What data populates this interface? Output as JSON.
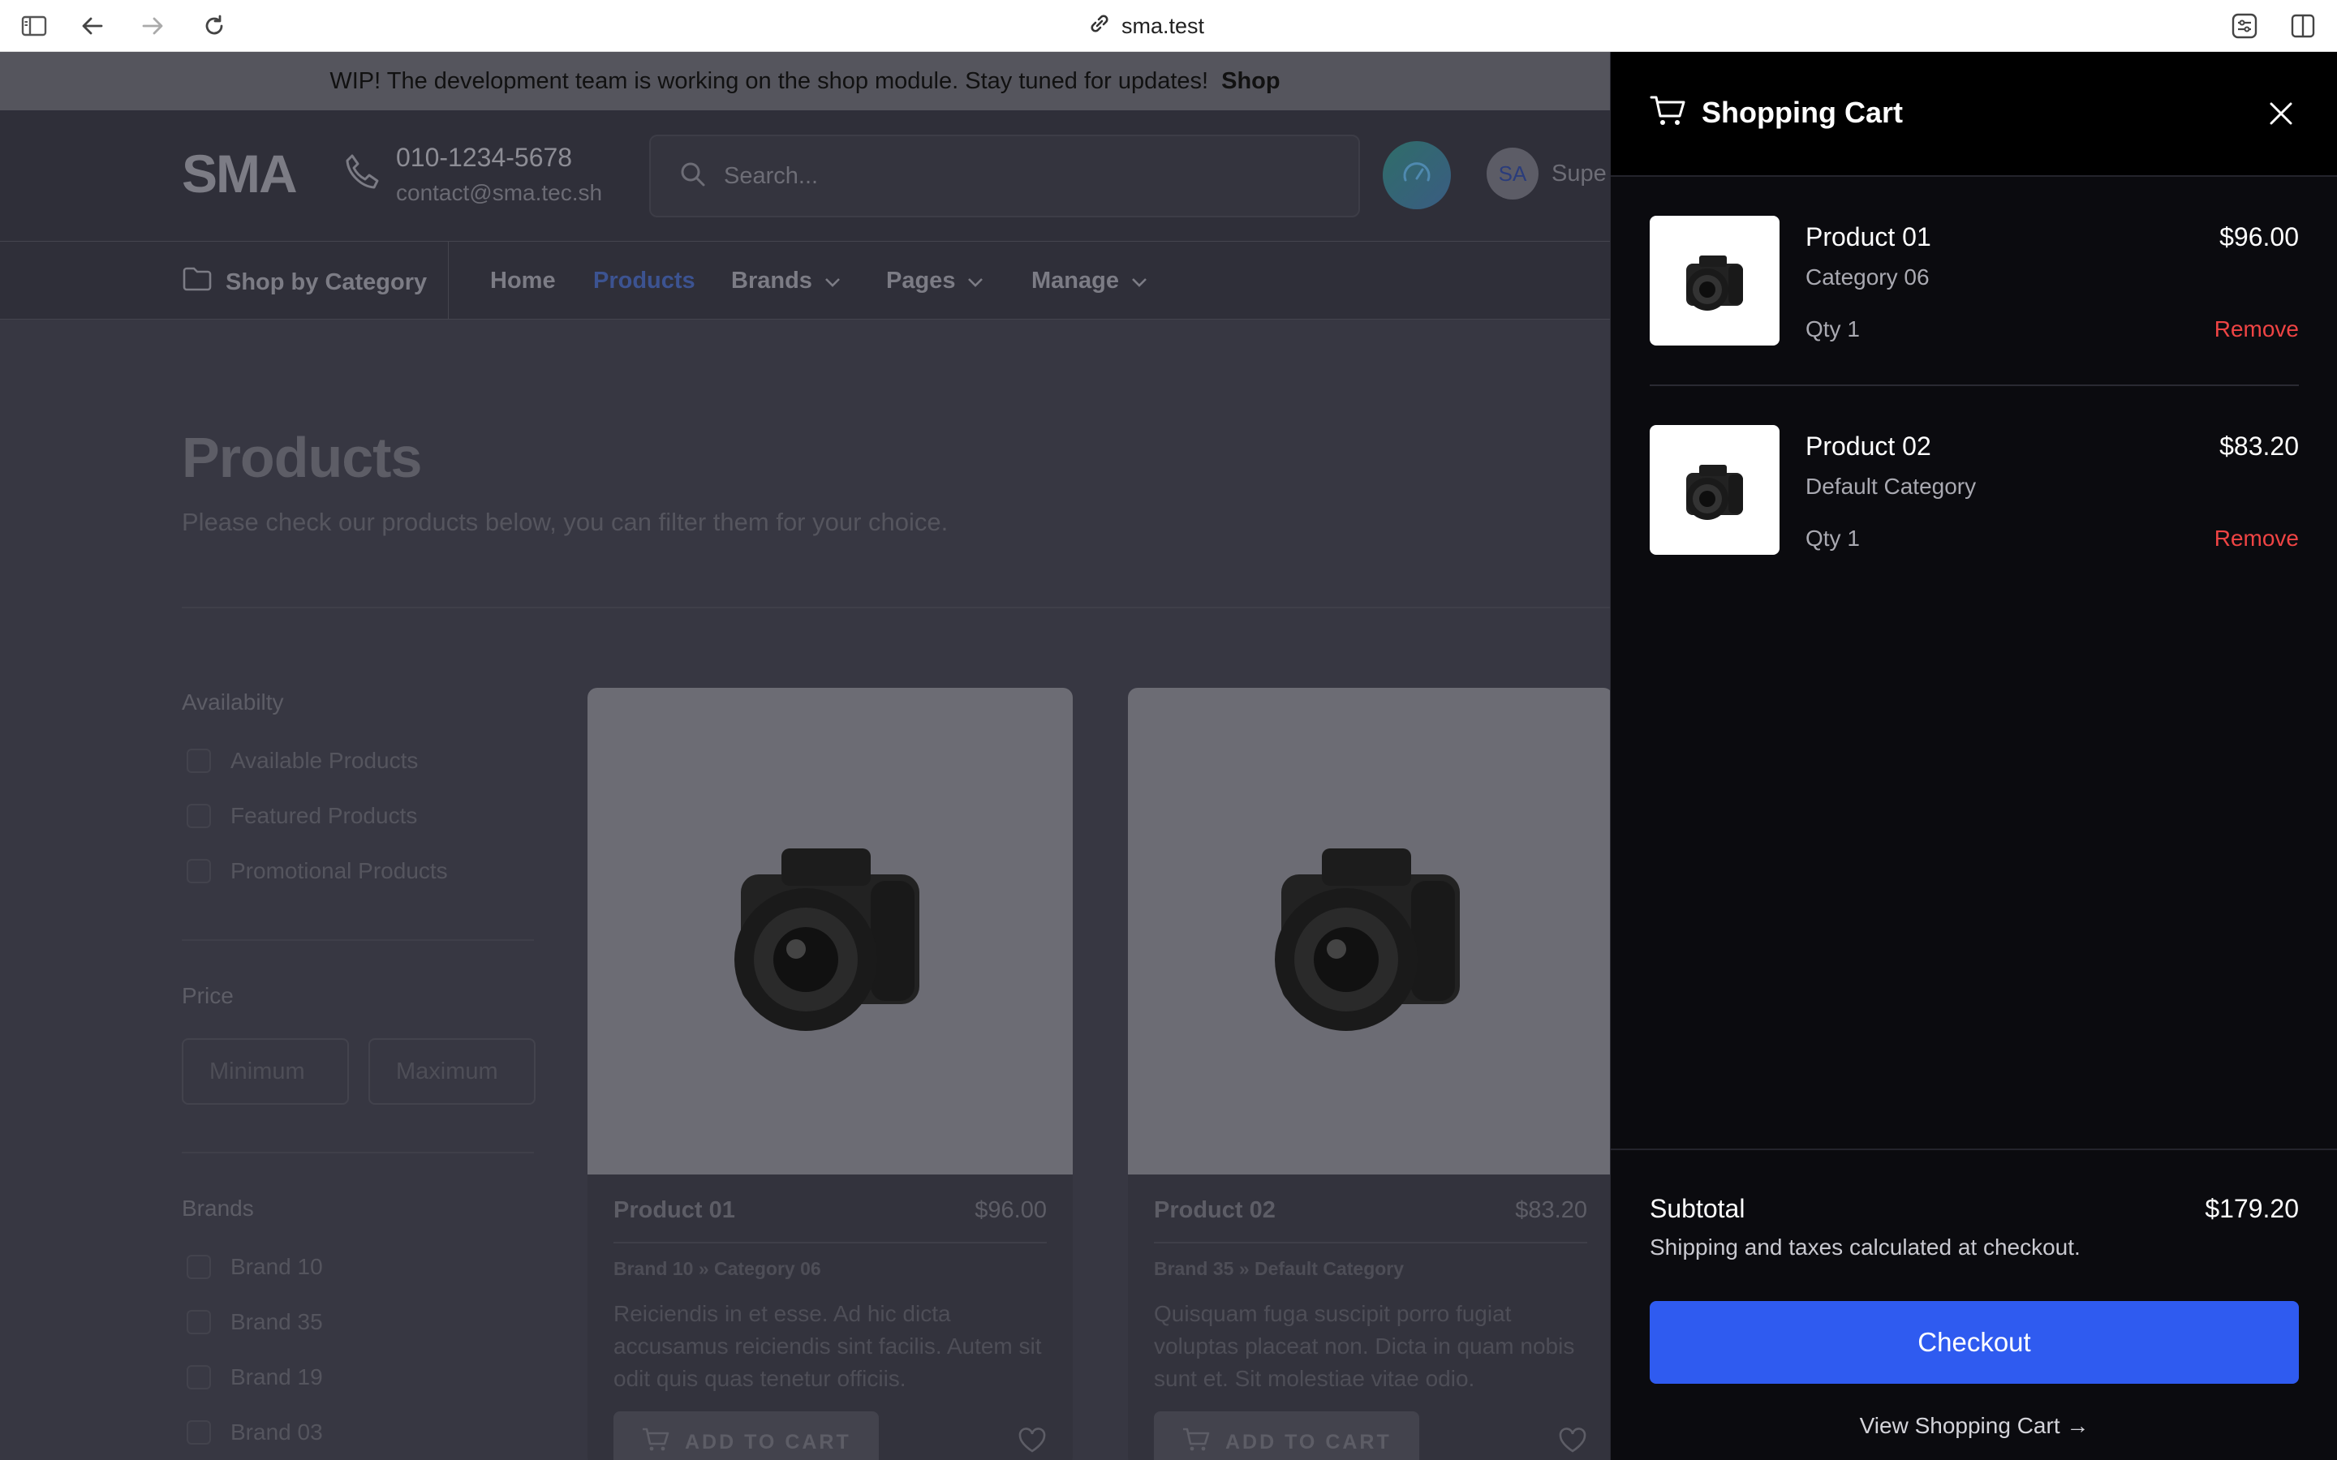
{
  "browser": {
    "url": "sma.test"
  },
  "announcement": {
    "text": "WIP! The development team is working on the shop module. Stay tuned for updates!",
    "link": "Shop"
  },
  "header": {
    "logo": "SMA",
    "phone": "010-1234-5678",
    "email": "contact@sma.tec.sh",
    "search_placeholder": "Search...",
    "avatar_initials": "SA",
    "user_name": "Supe"
  },
  "nav": {
    "category_label": "Shop by Category",
    "items": [
      {
        "label": "Home"
      },
      {
        "label": "Products"
      },
      {
        "label": "Brands"
      },
      {
        "label": "Pages"
      },
      {
        "label": "Manage"
      }
    ]
  },
  "page": {
    "title": "Products",
    "subtitle": "Please check our products below, you can filter them for your choice."
  },
  "filters": {
    "availability": {
      "heading": "Availabilty",
      "options": [
        "Available Products",
        "Featured Products",
        "Promotional Products"
      ]
    },
    "price": {
      "heading": "Price",
      "min_placeholder": "Minimum",
      "max_placeholder": "Maximum"
    },
    "brands": {
      "heading": "Brands",
      "options": [
        "Brand 10",
        "Brand 35",
        "Brand 19",
        "Brand 03"
      ]
    }
  },
  "products": [
    {
      "name": "Product 01",
      "price": "$96.00",
      "brand": "Brand 10",
      "sep": "»",
      "category": "Category 06",
      "description": "Reiciendis in et esse. Ad hic dicta accusamus reiciendis sint facilis. Autem sit odit quis quas tenetur officiis.",
      "add_to_cart": "ADD TO CART"
    },
    {
      "name": "Product 02",
      "price": "$83.20",
      "brand": "Brand 35",
      "sep": "»",
      "category": "Default Category",
      "description": "Quisquam fuga suscipit porro fugiat voluptas placeat non. Dicta in quam nobis sunt et. Sit molestiae vitae odio.",
      "add_to_cart": "ADD TO CART"
    }
  ],
  "cart": {
    "title": "Shopping Cart",
    "items": [
      {
        "name": "Product 01",
        "category": "Category 06",
        "qty": "Qty 1",
        "price": "$96.00",
        "remove": "Remove"
      },
      {
        "name": "Product 02",
        "category": "Default Category",
        "qty": "Qty 1",
        "price": "$83.20",
        "remove": "Remove"
      }
    ],
    "subtotal_label": "Subtotal",
    "subtotal_value": "$179.20",
    "note": "Shipping and taxes calculated at checkout.",
    "checkout_label": "Checkout",
    "view_cart_label": "View Shopping Cart →"
  },
  "colors": {
    "checkout": "#2f5bf0",
    "remove": "#ef4444",
    "nav_active": "#3c5391"
  }
}
